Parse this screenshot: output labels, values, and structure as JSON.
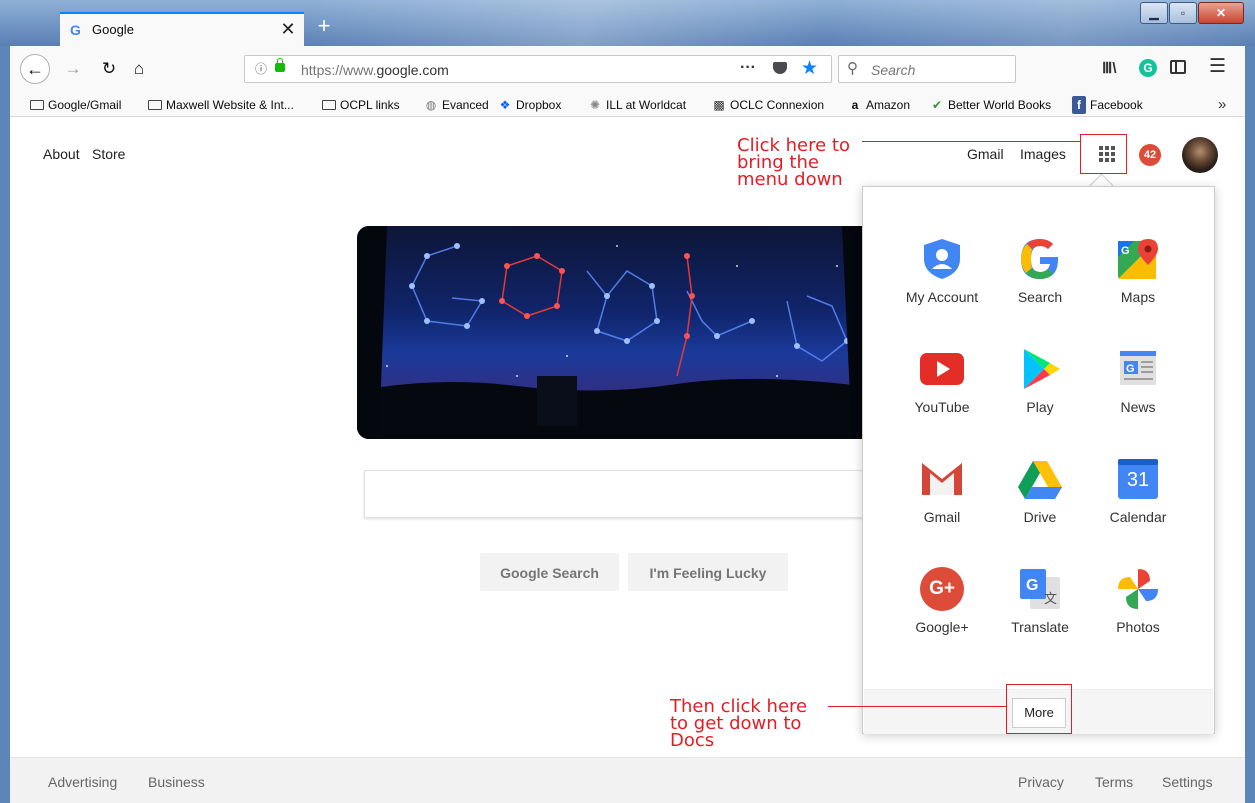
{
  "browser": {
    "tab_title": "Google",
    "tab_favicon": "G",
    "tab_close": "✕",
    "new_tab": "+",
    "url": "https://www.google.com",
    "url_prefix": "https://www.",
    "url_domain": "google.com",
    "search_placeholder": "Search",
    "ext_letter": "G",
    "icons": [
      "back-icon",
      "forward-icon",
      "reload-icon",
      "home-icon",
      "info-icon",
      "lock-icon",
      "page-actions-icon",
      "pocket-icon",
      "bookmark-star-icon",
      "search-icon",
      "library-icon",
      "grammarly-icon",
      "sidebar-icon",
      "menu-icon"
    ]
  },
  "bookmarks": [
    {
      "label": "Google/Gmail",
      "icon": "folder"
    },
    {
      "label": "Maxwell Website & Int...",
      "icon": "folder"
    },
    {
      "label": "OCPL links",
      "icon": "folder"
    },
    {
      "label": "Evanced",
      "icon": "globe"
    },
    {
      "label": "Dropbox",
      "icon": "dropbox"
    },
    {
      "label": "ILL at Worldcat",
      "icon": "worldcat"
    },
    {
      "label": "OCLC Connexion",
      "icon": "oclc"
    },
    {
      "label": "Amazon",
      "icon": "amazon"
    },
    {
      "label": "Better World Books",
      "icon": "bwb"
    },
    {
      "label": "Facebook",
      "icon": "facebook"
    }
  ],
  "google": {
    "about": "About",
    "store": "Store",
    "gmail": "Gmail",
    "images": "Images",
    "notification_count": "42",
    "search_button": "Google Search",
    "lucky_button": "I'm Feeling Lucky"
  },
  "apps_panel": {
    "apps": [
      {
        "label": "My Account"
      },
      {
        "label": "Search"
      },
      {
        "label": "Maps"
      },
      {
        "label": "YouTube"
      },
      {
        "label": "Play"
      },
      {
        "label": "News"
      },
      {
        "label": "Gmail"
      },
      {
        "label": "Drive"
      },
      {
        "label": "Calendar"
      },
      {
        "label": "Google+"
      },
      {
        "label": "Translate"
      },
      {
        "label": "Photos"
      }
    ],
    "calendar_day": "31",
    "google_plus": "G+",
    "more": "More"
  },
  "footer": {
    "advertising": "Advertising",
    "business": "Business",
    "privacy": "Privacy",
    "terms": "Terms",
    "settings": "Settings"
  },
  "annotations": {
    "top": [
      "Click here to",
      "bring the",
      "menu down"
    ],
    "bottom": [
      "Then click here",
      "to get down to",
      "Docs"
    ]
  },
  "colors": {
    "annotation": "#e51c23",
    "firefox_blue": "#0a84ff",
    "notification": "#dd4b39"
  }
}
